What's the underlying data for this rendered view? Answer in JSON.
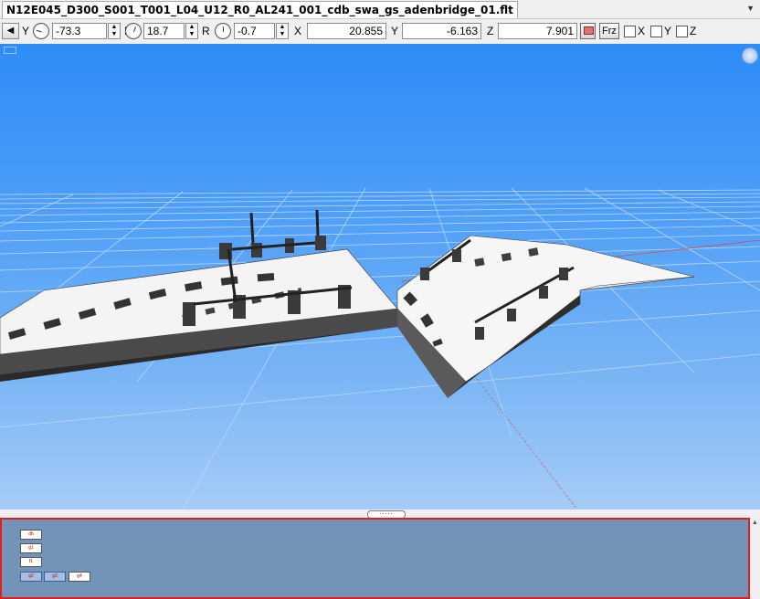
{
  "window": {
    "tab_title": "N12E045_D300_S001_T001_L04_U12_R0_AL241_001_cdb_swa_gs_adenbridge_01.flt"
  },
  "toolbar": {
    "yaw_label": "Y",
    "yaw_value": "-73.3",
    "pitch_label": "P",
    "pitch_value": "18.7",
    "roll_label": "R",
    "roll_value": "-0.7",
    "x_label": "X",
    "x_value": "20.855",
    "y_label": "Y",
    "y_value": "-6.163",
    "z_label": "Z",
    "z_value": "7.901",
    "freeze_label": "Frz",
    "lock_x_label": "X",
    "lock_y_label": "Y",
    "lock_z_label": "Z"
  },
  "splitter": {
    "handle_label": "....."
  },
  "tree": {
    "nodes": [
      "db",
      "g1",
      "f1",
      "g2",
      "g3",
      "g4"
    ],
    "selected": [
      "g2",
      "g3"
    ]
  },
  "colors": {
    "sky_top": "#2d8cf7",
    "sky_bottom": "#a6ccf7",
    "panel": "#7393b8",
    "panel_border": "#e02020"
  }
}
